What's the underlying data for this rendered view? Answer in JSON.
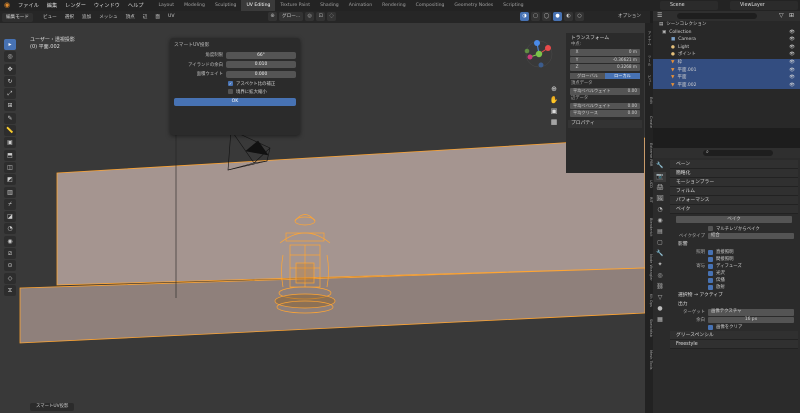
{
  "app": {
    "menu": [
      "ファイル",
      "編集",
      "レンダー",
      "ウィンドウ",
      "ヘルプ"
    ],
    "workspaces": [
      "Layout",
      "Modeling",
      "Sculpting",
      "UV Editing",
      "Texture Paint",
      "Shading",
      "Animation",
      "Rendering",
      "Compositing",
      "Geometry Nodes",
      "Scripting"
    ],
    "active_workspace": "UV Editing",
    "scene": "Scene",
    "view_layer": "ViewLayer"
  },
  "viewport_header": {
    "mode": "編集モード",
    "menus": [
      "ビュー",
      "選択",
      "追加",
      "メッシュ",
      "頂点",
      "辺",
      "面",
      "UV"
    ],
    "transform_label": "グロー...",
    "options_label": "オプション"
  },
  "viewport": {
    "view_name": "ユーザー・透視投影",
    "object_name": "(0) 平面.002"
  },
  "operator_panel": {
    "title": "スマートUV投影",
    "rows": [
      {
        "label": "角度制限",
        "value": "66°"
      },
      {
        "label": "アイランドの余白",
        "value": "0.010"
      },
      {
        "label": "面積ウェイト",
        "value": "0.000"
      }
    ],
    "checks": [
      {
        "label": "アスペクト比の補正",
        "checked": true
      },
      {
        "label": "境界に拡大縮小",
        "checked": false
      }
    ],
    "ok": "OK"
  },
  "npanel": {
    "header": "トランスフォーム",
    "vertex_label": "中点:",
    "coords": [
      {
        "axis": "X",
        "value": "0 m"
      },
      {
        "axis": "Y",
        "value": "-0.36621 m"
      },
      {
        "axis": "Z",
        "value": "0.3268 m"
      }
    ],
    "global": "グローバル",
    "local": "ローカル",
    "vertex_data": "頂点データ",
    "mean_bevel_weight": "平均ベベルウェイト",
    "mean_bevel_value": "0.00",
    "edge_data": "辺データ",
    "mean_bevel_weight2": "平均ベベルウェイト",
    "mean_bevel_value2": "0.00",
    "mean_crease": "平均クリース",
    "mean_crease_value": "0.00",
    "properties": "プロパティ"
  },
  "side_tabs": [
    "アイテム",
    "ツール",
    "ビュー",
    "Edit",
    "Create",
    "Extreme PBR",
    "UCD",
    "RIT",
    "Blenderkit",
    "Node Wrangler",
    "Kit Ops",
    "Sketchfab",
    "Mesh Tools"
  ],
  "outliner": {
    "title": "シーンコレクション",
    "items": [
      {
        "name": "Collection",
        "indent": 1,
        "icon": "▣",
        "color": "#bbbbbb",
        "selected": false
      },
      {
        "name": "Camera",
        "indent": 2,
        "icon": "■",
        "color": "#7aa0c8",
        "selected": false
      },
      {
        "name": "Light",
        "indent": 2,
        "icon": "●",
        "color": "#e5c07b",
        "selected": false
      },
      {
        "name": "ポイント",
        "indent": 2,
        "icon": "●",
        "color": "#e5c07b",
        "selected": false
      },
      {
        "name": "枠",
        "indent": 2,
        "icon": "▼",
        "color": "#e69138",
        "selected": true
      },
      {
        "name": "平面.001",
        "indent": 2,
        "icon": "▼",
        "color": "#e69138",
        "selected": true
      },
      {
        "name": "平面",
        "indent": 2,
        "icon": "▼",
        "color": "#e69138",
        "selected": true
      },
      {
        "name": "平面.002",
        "indent": 2,
        "icon": "▼",
        "color": "#e69138",
        "selected": true
      }
    ]
  },
  "properties": {
    "sections": [
      "ベーン",
      "簡略化",
      "モーションブラー",
      "フィルム",
      "パフォーマンス",
      "ベイク"
    ],
    "bake_button": "ベイク",
    "multires_bake": "マルチレゾからベイク",
    "bake_type_label": "ベイクタイプ",
    "bake_type_value": "結合",
    "influence": "影響",
    "lighting_label": "照明",
    "lighting": [
      "直接照明",
      "間接照明"
    ],
    "contrib_label": "寄与",
    "contrib": [
      "ディフューズ",
      "光沢",
      "伝播",
      "放射"
    ],
    "selected_active": "選択物 → アクティブ",
    "output": "出力",
    "target_label": "ターゲット",
    "target_value": "画像テクスチャ",
    "margin_label": "余白",
    "margin_value": "16 px",
    "clear_image": "画像をクリア",
    "grease_pencil": "グリースペンシル",
    "freestyle": "Freestyle"
  },
  "toolbar_icons": [
    "select-box",
    "cursor",
    "move",
    "rotate",
    "scale",
    "transform",
    "annotate",
    "measure",
    "add-cube",
    "extrude",
    "inset",
    "bevel",
    "loop-cut",
    "knife",
    "poly-build",
    "spin",
    "smooth",
    "edge-slide",
    "shrink-fatten",
    "shear",
    "rip"
  ],
  "status": {
    "last_op": "スマートUV投影"
  },
  "colors": {
    "accent": "#4772b3",
    "selection_orange": "#ffa533",
    "viewport_bg": "#393939"
  }
}
